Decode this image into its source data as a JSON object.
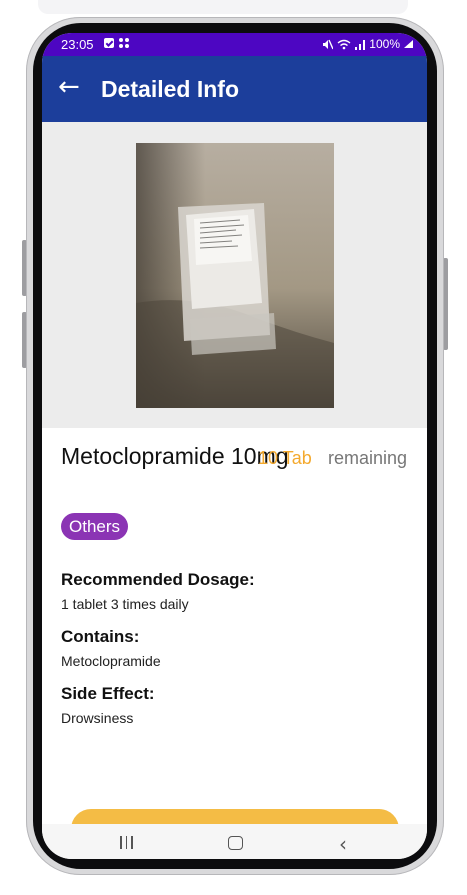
{
  "status_bar": {
    "time": "23:05",
    "battery_text": "100%",
    "icons": [
      "check-box-icon",
      "grid-dots-icon",
      "mute-icon",
      "wifi-icon",
      "signal-icon",
      "battery-icon"
    ],
    "background_color": "#4d06c2"
  },
  "app_bar": {
    "back_icon": "arrow-left-icon",
    "title": "Detailed Info",
    "background_color": "#1c3e9b"
  },
  "medicine": {
    "name": "Metoclopramide 10mg",
    "quantity": "10 Tab",
    "remaining_label": "remaining",
    "category": "Others",
    "quantity_color": "#f4a92d",
    "category_color": "#8b34b4"
  },
  "details": {
    "dosage_title": "Recommended Dosage:",
    "dosage_value": "1 tablet 3 times daily",
    "contains_title": "Contains:",
    "contains_value": "Metoclopramide",
    "side_effect_title": "Side Effect:",
    "side_effect_value": "Drowsiness"
  },
  "action_button": {
    "color": "#f4bc45"
  },
  "nav_bar": {
    "icons": [
      "recents-icon",
      "home-icon",
      "back-chevron-icon"
    ]
  }
}
